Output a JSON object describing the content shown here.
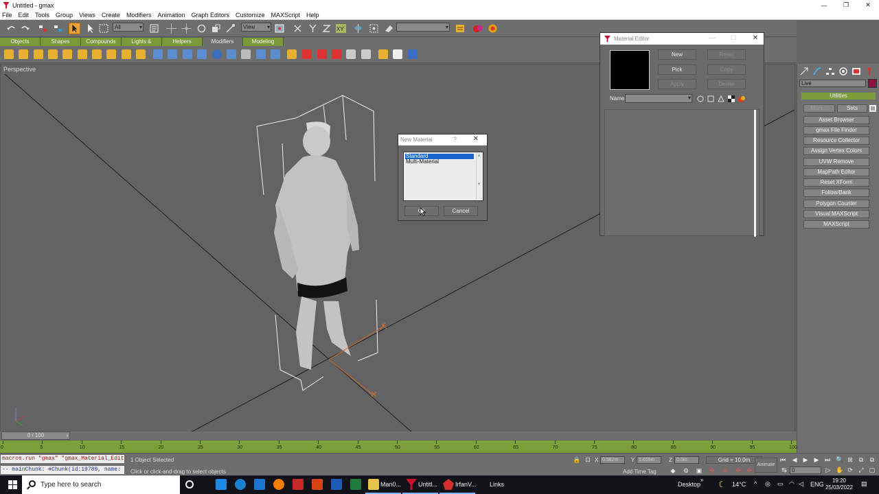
{
  "window": {
    "title": "Untitled - gmax",
    "minimize": "—",
    "restore": "❐",
    "close": "✕"
  },
  "menu": [
    "File",
    "Edit",
    "Tools",
    "Group",
    "Views",
    "Create",
    "Modifiers",
    "Animation",
    "Graph Editors",
    "Customize",
    "MAXScript",
    "Help"
  ],
  "toolbar": {
    "selection_filter": "All",
    "reference_coord": "View",
    "named_selection": ""
  },
  "tabs": [
    "Objects",
    "Shapes",
    "Compounds",
    "Lights & Cameras",
    "Helpers",
    "Modifiers",
    "Modeling"
  ],
  "active_tab": "Modifiers",
  "viewport": {
    "label": "Perspective",
    "axis_x": "x",
    "axis_y": "y"
  },
  "command_panel": {
    "live_field": "Live",
    "live_swatch_color": "#8e1140",
    "rollout_title": "Utilities",
    "more_button": "More...",
    "sets_button": "Sets",
    "utilities": [
      "Asset Browser",
      "gmax File Finder",
      "Resource Collector",
      "Assign Vertex Colors",
      "UVW Remove",
      "MapPath Editor",
      "Reset XForm",
      "Follow/Bank",
      "Polygon Counter",
      "Visual MAXScript",
      "MAXScript"
    ]
  },
  "material_editor": {
    "title": "Material Editor",
    "minimize": "—",
    "maximize": "☐",
    "close": "✕",
    "buttons": {
      "new": "New",
      "pick": "Pick",
      "apply": "Apply",
      "reset": "Reset",
      "copy": "Copy",
      "delete": "Delete"
    },
    "name_label": "Name",
    "name_value": ""
  },
  "new_material": {
    "title": "New Material",
    "help": "?",
    "close": "✕",
    "items": [
      "Standard",
      "Multi-Material"
    ],
    "selected": "Standard",
    "ok_button": "Ok",
    "cancel_button": "Cancel"
  },
  "timeline": {
    "slider": "0 / 100",
    "ticks": [
      "0",
      "5",
      "10",
      "15",
      "20",
      "25",
      "30",
      "35",
      "40",
      "45",
      "50",
      "55",
      "60",
      "65",
      "70",
      "75",
      "80",
      "85",
      "90",
      "95",
      "100"
    ]
  },
  "status": {
    "listener_line1": "macros.run \"gmax\" \"gmax_Material_Editor\"",
    "listener_line2": "--  mainChunk: #Chunk(id:19789, name:",
    "selection": "1 Object Selected",
    "prompt": "Click or click-and-drag to select objects",
    "x_label": "X",
    "x_value": "0.982m",
    "y_label": "Y",
    "y_value": "1.655m",
    "z_label": "Z",
    "z_value": "0.0m",
    "grid": "Grid = 10.0m",
    "add_time_tag": "Add Time Tag",
    "animate": "Animate",
    "frame": "0"
  },
  "taskbar": {
    "search_placeholder": "Type here to search",
    "apps": [
      {
        "label": "Man0...",
        "icon": "folder-icon"
      },
      {
        "label": "Untitl...",
        "icon": "gmax-icon"
      },
      {
        "label": "IrfanV...",
        "icon": "irfanview-icon"
      },
      {
        "label": "Links",
        "icon": ""
      }
    ],
    "desktop": "Desktop",
    "weather": "14°C",
    "language": "ENG",
    "time": "19:20",
    "date": "25/03/2022"
  }
}
